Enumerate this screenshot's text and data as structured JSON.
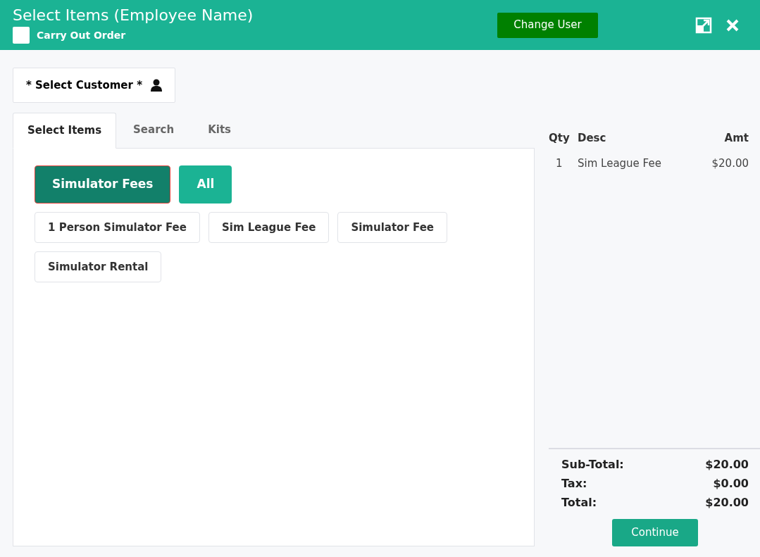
{
  "header": {
    "title": "Select Items (Employee Name)",
    "carry_out": {
      "label": "Carry Out Order",
      "checked": false
    },
    "change_user": "Change User"
  },
  "customer_button": "* Select Customer *",
  "tabs": [
    {
      "label": "Select Items",
      "selected": true
    },
    {
      "label": "Search",
      "selected": false
    },
    {
      "label": "Kits",
      "selected": false
    }
  ],
  "categories": [
    {
      "label": "Simulator Fees",
      "selected": true
    },
    {
      "label": "All",
      "selected": false
    }
  ],
  "items": [
    "1 Person Simulator Fee",
    "Sim League Fee",
    "Simulator Fee",
    "Simulator Rental"
  ],
  "order": {
    "columns": [
      "Qty",
      "Desc",
      "Amt"
    ],
    "rows": [
      {
        "qty": "1",
        "desc": "Sim League Fee",
        "amt": "$20.00"
      }
    ],
    "totals": [
      {
        "label": "Sub-Total:",
        "value": "$20.00"
      },
      {
        "label": "Tax:",
        "value": "$0.00"
      },
      {
        "label": "Total:",
        "value": "$20.00"
      }
    ],
    "continue": "Continue"
  }
}
